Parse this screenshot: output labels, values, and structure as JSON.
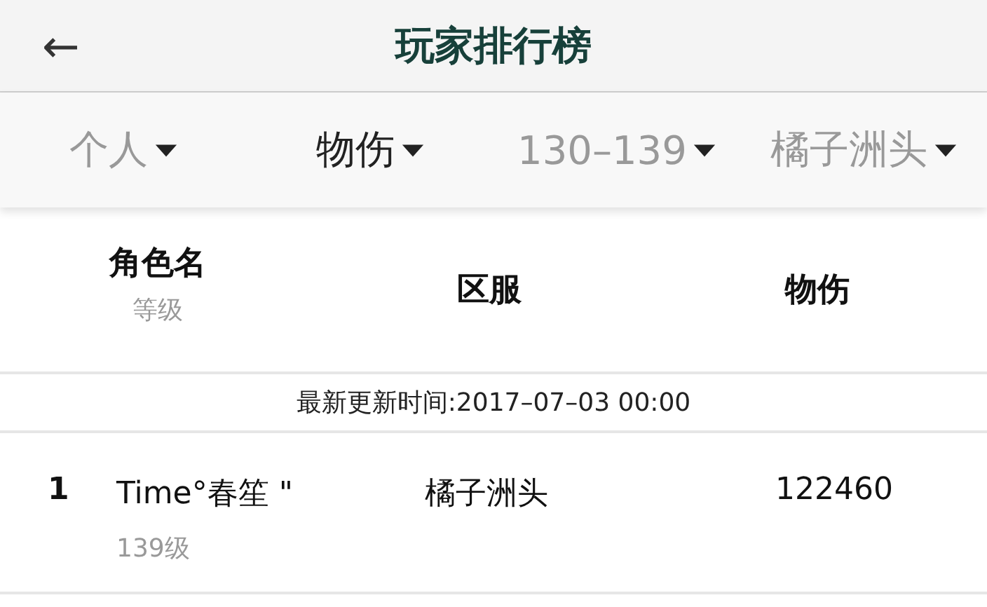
{
  "header": {
    "back": "←",
    "title": "玩家排行榜"
  },
  "filters": [
    {
      "label": "个人",
      "selected": false
    },
    {
      "label": "物伤",
      "selected": true
    },
    {
      "label": "130–139",
      "selected": false
    },
    {
      "label": "橘子洲头",
      "selected": false
    }
  ],
  "table": {
    "columns": [
      {
        "title": "角色名",
        "subtitle": "等级"
      },
      {
        "title": "区服"
      },
      {
        "title": "物伤"
      }
    ],
    "update_time": "最新更新时间:2017–07–03 00:00",
    "rows": [
      {
        "rank": "1",
        "name": "Time°春笙 \"",
        "level": "139级",
        "server": "橘子洲头",
        "value": "122460"
      }
    ]
  }
}
